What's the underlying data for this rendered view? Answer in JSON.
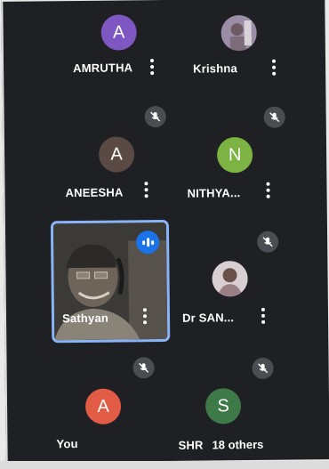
{
  "participants": [
    {
      "name": "AMRUTHA",
      "initial": "A",
      "color": "#7e57c2"
    },
    {
      "name": "Krishna",
      "initial": "",
      "color": "#9b8da6"
    },
    {
      "name": "ANEESHA",
      "initial": "A",
      "color": "#5b4a43"
    },
    {
      "name": "NITHYA...",
      "initial": "N",
      "color": "#7cb342"
    },
    {
      "name": "Sathyan",
      "initial": "",
      "color": "#8ab4f8"
    },
    {
      "name": "Dr SAN...",
      "initial": "",
      "color": "#cbbfc6"
    },
    {
      "name": "You",
      "initial": "A",
      "color": "#e25b45"
    },
    {
      "name": "SHR",
      "initial": "S",
      "color": "#3d7a48"
    }
  ],
  "others_label": "18 others",
  "colors": {
    "background": "#1f2023",
    "active_border": "#8ab4f8",
    "speaking": "#1a73e8",
    "mute_badge": "#4b4d52"
  },
  "icons": [
    "more-vert-icon",
    "mic-off-icon",
    "speaking-indicator-icon"
  ]
}
